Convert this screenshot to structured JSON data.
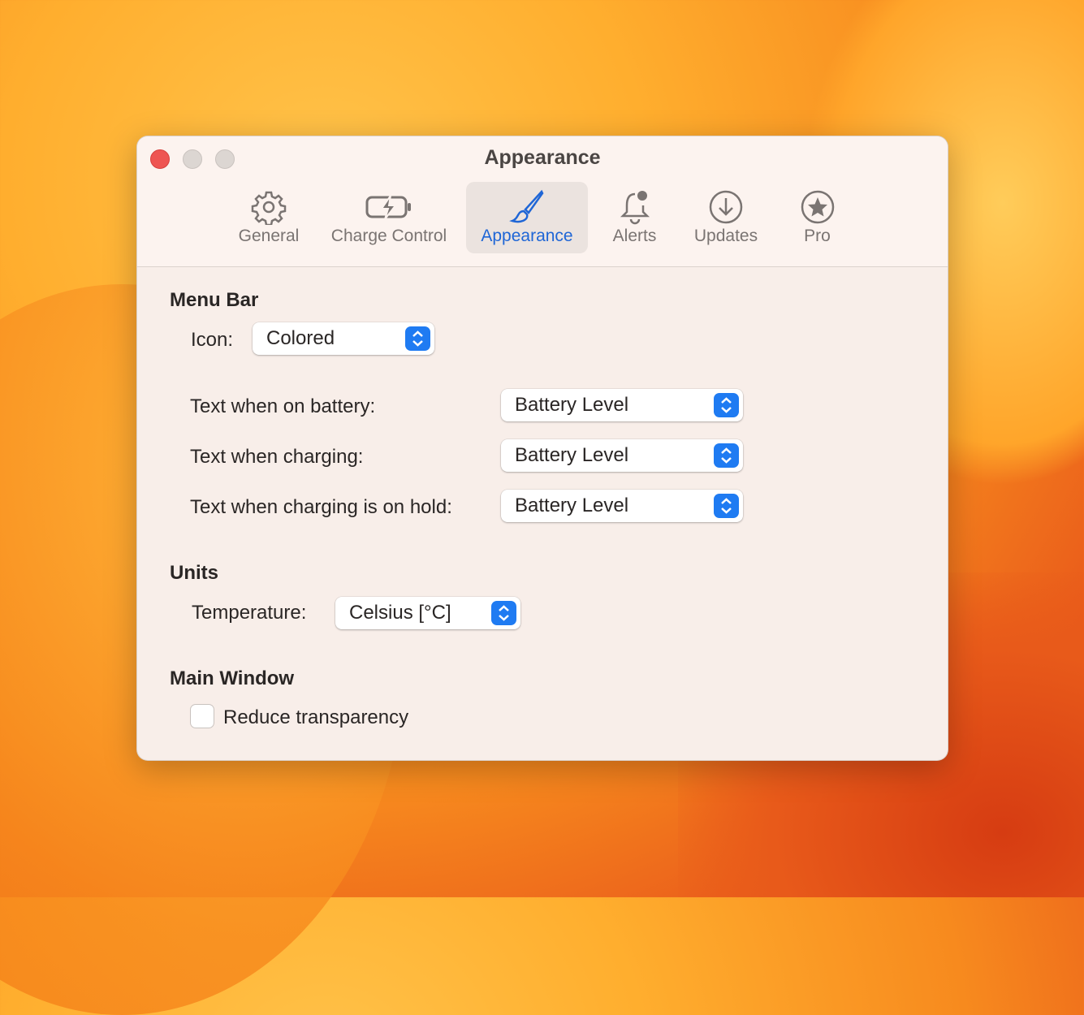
{
  "window": {
    "title": "Appearance"
  },
  "tabs": [
    {
      "label": "General"
    },
    {
      "label": "Charge Control"
    },
    {
      "label": "Appearance"
    },
    {
      "label": "Alerts"
    },
    {
      "label": "Updates"
    },
    {
      "label": "Pro"
    }
  ],
  "menu_bar": {
    "heading": "Menu Bar",
    "icon_label": "Icon:",
    "icon_value": "Colored",
    "on_battery_label": "Text when on battery:",
    "on_battery_value": "Battery Level",
    "charging_label": "Text when charging:",
    "charging_value": "Battery Level",
    "on_hold_label": "Text when charging is on hold:",
    "on_hold_value": "Battery Level"
  },
  "units": {
    "heading": "Units",
    "temperature_label": "Temperature:",
    "temperature_value": "Celsius [°C]"
  },
  "main_window": {
    "heading": "Main Window",
    "reduce_transparency_label": "Reduce transparency",
    "reduce_transparency_checked": false
  },
  "colors": {
    "accent": "#1f7bf2",
    "close": "#ee5552"
  }
}
